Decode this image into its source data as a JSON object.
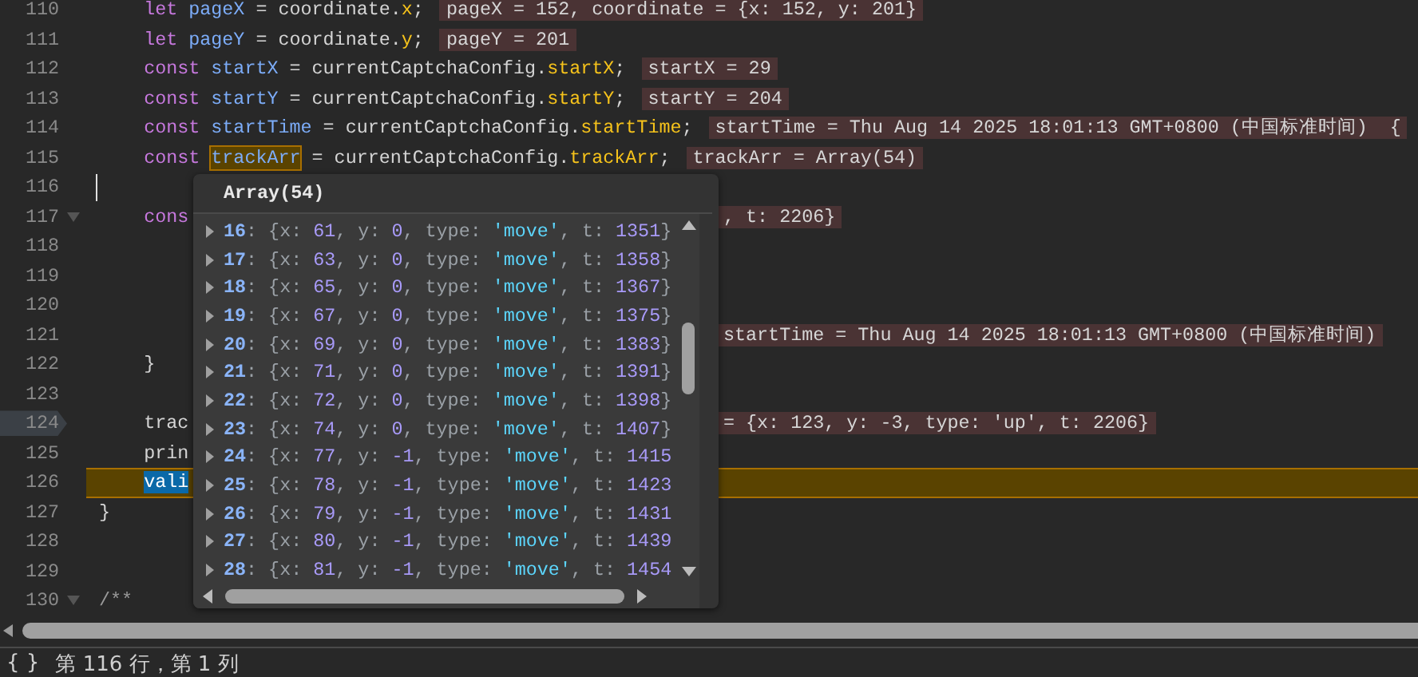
{
  "editor": {
    "lines": [
      {
        "number": "110",
        "paused": false,
        "breakpoint": false,
        "foldable": false,
        "cursor": false,
        "segments": [
          {
            "kind": "kw",
            "text": "    let "
          },
          {
            "kind": "var",
            "text": "pageX"
          },
          {
            "kind": "plain",
            "text": " = coordinate."
          },
          {
            "kind": "prop",
            "text": "x"
          },
          {
            "kind": "plain",
            "text": ";"
          }
        ],
        "inline_value": {
          "text": "pageX = 152, coordinate = {x: 152, y: 201}",
          "behind_popup": false
        }
      },
      {
        "number": "111",
        "paused": false,
        "breakpoint": false,
        "foldable": false,
        "cursor": false,
        "segments": [
          {
            "kind": "kw",
            "text": "    let "
          },
          {
            "kind": "var",
            "text": "pageY"
          },
          {
            "kind": "plain",
            "text": " = coordinate."
          },
          {
            "kind": "prop",
            "text": "y"
          },
          {
            "kind": "plain",
            "text": ";"
          }
        ],
        "inline_value": {
          "text": "pageY = 201",
          "behind_popup": false
        }
      },
      {
        "number": "112",
        "paused": false,
        "breakpoint": false,
        "foldable": false,
        "cursor": false,
        "segments": [
          {
            "kind": "kw",
            "text": "    const "
          },
          {
            "kind": "var",
            "text": "startX"
          },
          {
            "kind": "plain",
            "text": " = currentCaptchaConfig."
          },
          {
            "kind": "prop",
            "text": "startX"
          },
          {
            "kind": "plain",
            "text": ";"
          }
        ],
        "inline_value": {
          "text": "startX = 29",
          "behind_popup": false
        }
      },
      {
        "number": "113",
        "paused": false,
        "breakpoint": false,
        "foldable": false,
        "cursor": false,
        "segments": [
          {
            "kind": "kw",
            "text": "    const "
          },
          {
            "kind": "var",
            "text": "startY"
          },
          {
            "kind": "plain",
            "text": " = currentCaptchaConfig."
          },
          {
            "kind": "prop",
            "text": "startY"
          },
          {
            "kind": "plain",
            "text": ";"
          }
        ],
        "inline_value": {
          "text": "startY = 204",
          "behind_popup": false
        }
      },
      {
        "number": "114",
        "paused": false,
        "breakpoint": false,
        "foldable": false,
        "cursor": false,
        "segments": [
          {
            "kind": "kw",
            "text": "    const "
          },
          {
            "kind": "var",
            "text": "startTime"
          },
          {
            "kind": "plain",
            "text": " = currentCaptchaConfig."
          },
          {
            "kind": "prop",
            "text": "startTime"
          },
          {
            "kind": "plain",
            "text": ";"
          }
        ],
        "inline_value": {
          "text": "startTime = Thu Aug 14 2025 18:01:13 GMT+0800 (中国标准时间)  {",
          "behind_popup": false
        }
      },
      {
        "number": "115",
        "paused": false,
        "breakpoint": false,
        "foldable": false,
        "cursor": false,
        "segments": [
          {
            "kind": "kw",
            "text": "    const "
          },
          {
            "kind": "match",
            "text": "trackArr"
          },
          {
            "kind": "plain",
            "text": " = currentCaptchaConfig."
          },
          {
            "kind": "prop",
            "text": "trackArr"
          },
          {
            "kind": "plain",
            "text": ";"
          }
        ],
        "inline_value": {
          "text": "trackArr = Array(54)",
          "behind_popup": false
        }
      },
      {
        "number": "116",
        "paused": false,
        "breakpoint": false,
        "foldable": false,
        "cursor": true
      },
      {
        "number": "117",
        "paused": false,
        "breakpoint": false,
        "foldable": true,
        "cursor": false,
        "segments": [
          {
            "kind": "kw",
            "text": "    cons"
          }
        ],
        "inline_value": {
          "text": ", t: 2206}",
          "behind_popup": true
        }
      },
      {
        "number": "118",
        "paused": false,
        "breakpoint": false,
        "foldable": false,
        "cursor": false
      },
      {
        "number": "119",
        "paused": false,
        "breakpoint": false,
        "foldable": false,
        "cursor": false
      },
      {
        "number": "120",
        "paused": false,
        "breakpoint": false,
        "foldable": false,
        "cursor": false
      },
      {
        "number": "121",
        "paused": false,
        "breakpoint": false,
        "foldable": false,
        "cursor": false,
        "inline_value": {
          "text": "startTime = Thu Aug 14 2025 18:01:13 GMT+0800 (中国标准时间)",
          "behind_popup": true
        }
      },
      {
        "number": "122",
        "paused": false,
        "breakpoint": false,
        "foldable": false,
        "cursor": false,
        "segments": [
          {
            "kind": "plain",
            "text": "    }"
          }
        ]
      },
      {
        "number": "123",
        "paused": false,
        "breakpoint": false,
        "foldable": false,
        "cursor": false
      },
      {
        "number": "124",
        "paused": false,
        "breakpoint": true,
        "foldable": false,
        "cursor": false,
        "segments": [
          {
            "kind": "plain",
            "text": "    trac"
          }
        ],
        "inline_value": {
          "text": "= {x: 123, y: -3, type: 'up', t: 2206}",
          "behind_popup": true
        }
      },
      {
        "number": "125",
        "paused": false,
        "breakpoint": false,
        "foldable": false,
        "cursor": false,
        "segments": [
          {
            "kind": "plain",
            "text": "    prin"
          }
        ]
      },
      {
        "number": "126",
        "paused": true,
        "breakpoint": false,
        "foldable": false,
        "cursor": false,
        "segments": [
          {
            "kind": "sel",
            "text": "    vali"
          }
        ]
      },
      {
        "number": "127",
        "paused": false,
        "breakpoint": false,
        "foldable": false,
        "cursor": false,
        "segments": [
          {
            "kind": "plain",
            "text": "}"
          }
        ]
      },
      {
        "number": "128",
        "paused": false,
        "breakpoint": false,
        "foldable": false,
        "cursor": false
      },
      {
        "number": "129",
        "paused": false,
        "breakpoint": false,
        "foldable": false,
        "cursor": false
      },
      {
        "number": "130",
        "paused": false,
        "breakpoint": false,
        "foldable": true,
        "cursor": false,
        "segments": [
          {
            "kind": "comment",
            "text": "/**"
          }
        ]
      }
    ]
  },
  "popup": {
    "title": "Array(54)",
    "entries": [
      {
        "index": "16",
        "tokens": [
          {
            "kind": "punct",
            "text": ": {x: "
          },
          {
            "kind": "num",
            "text": "61"
          },
          {
            "kind": "punct",
            "text": ", y: "
          },
          {
            "kind": "num",
            "text": "0"
          },
          {
            "kind": "punct",
            "text": ", type: "
          },
          {
            "kind": "str",
            "text": "'move'"
          },
          {
            "kind": "punct",
            "text": ", t: "
          },
          {
            "kind": "num",
            "text": "1351"
          },
          {
            "kind": "punct",
            "text": "}"
          }
        ]
      },
      {
        "index": "17",
        "tokens": [
          {
            "kind": "punct",
            "text": ": {x: "
          },
          {
            "kind": "num",
            "text": "63"
          },
          {
            "kind": "punct",
            "text": ", y: "
          },
          {
            "kind": "num",
            "text": "0"
          },
          {
            "kind": "punct",
            "text": ", type: "
          },
          {
            "kind": "str",
            "text": "'move'"
          },
          {
            "kind": "punct",
            "text": ", t: "
          },
          {
            "kind": "num",
            "text": "1358"
          },
          {
            "kind": "punct",
            "text": "}"
          }
        ]
      },
      {
        "index": "18",
        "tokens": [
          {
            "kind": "punct",
            "text": ": {x: "
          },
          {
            "kind": "num",
            "text": "65"
          },
          {
            "kind": "punct",
            "text": ", y: "
          },
          {
            "kind": "num",
            "text": "0"
          },
          {
            "kind": "punct",
            "text": ", type: "
          },
          {
            "kind": "str",
            "text": "'move'"
          },
          {
            "kind": "punct",
            "text": ", t: "
          },
          {
            "kind": "num",
            "text": "1367"
          },
          {
            "kind": "punct",
            "text": "}"
          }
        ]
      },
      {
        "index": "19",
        "tokens": [
          {
            "kind": "punct",
            "text": ": {x: "
          },
          {
            "kind": "num",
            "text": "67"
          },
          {
            "kind": "punct",
            "text": ", y: "
          },
          {
            "kind": "num",
            "text": "0"
          },
          {
            "kind": "punct",
            "text": ", type: "
          },
          {
            "kind": "str",
            "text": "'move'"
          },
          {
            "kind": "punct",
            "text": ", t: "
          },
          {
            "kind": "num",
            "text": "1375"
          },
          {
            "kind": "punct",
            "text": "}"
          }
        ]
      },
      {
        "index": "20",
        "tokens": [
          {
            "kind": "punct",
            "text": ": {x: "
          },
          {
            "kind": "num",
            "text": "69"
          },
          {
            "kind": "punct",
            "text": ", y: "
          },
          {
            "kind": "num",
            "text": "0"
          },
          {
            "kind": "punct",
            "text": ", type: "
          },
          {
            "kind": "str",
            "text": "'move'"
          },
          {
            "kind": "punct",
            "text": ", t: "
          },
          {
            "kind": "num",
            "text": "1383"
          },
          {
            "kind": "punct",
            "text": "}"
          }
        ]
      },
      {
        "index": "21",
        "tokens": [
          {
            "kind": "punct",
            "text": ": {x: "
          },
          {
            "kind": "num",
            "text": "71"
          },
          {
            "kind": "punct",
            "text": ", y: "
          },
          {
            "kind": "num",
            "text": "0"
          },
          {
            "kind": "punct",
            "text": ", type: "
          },
          {
            "kind": "str",
            "text": "'move'"
          },
          {
            "kind": "punct",
            "text": ", t: "
          },
          {
            "kind": "num",
            "text": "1391"
          },
          {
            "kind": "punct",
            "text": "}"
          }
        ]
      },
      {
        "index": "22",
        "tokens": [
          {
            "kind": "punct",
            "text": ": {x: "
          },
          {
            "kind": "num",
            "text": "72"
          },
          {
            "kind": "punct",
            "text": ", y: "
          },
          {
            "kind": "num",
            "text": "0"
          },
          {
            "kind": "punct",
            "text": ", type: "
          },
          {
            "kind": "str",
            "text": "'move'"
          },
          {
            "kind": "punct",
            "text": ", t: "
          },
          {
            "kind": "num",
            "text": "1398"
          },
          {
            "kind": "punct",
            "text": "}"
          }
        ]
      },
      {
        "index": "23",
        "tokens": [
          {
            "kind": "punct",
            "text": ": {x: "
          },
          {
            "kind": "num",
            "text": "74"
          },
          {
            "kind": "punct",
            "text": ", y: "
          },
          {
            "kind": "num",
            "text": "0"
          },
          {
            "kind": "punct",
            "text": ", type: "
          },
          {
            "kind": "str",
            "text": "'move'"
          },
          {
            "kind": "punct",
            "text": ", t: "
          },
          {
            "kind": "num",
            "text": "1407"
          },
          {
            "kind": "punct",
            "text": "}"
          }
        ]
      },
      {
        "index": "24",
        "tokens": [
          {
            "kind": "punct",
            "text": ": {x: "
          },
          {
            "kind": "num",
            "text": "77"
          },
          {
            "kind": "punct",
            "text": ", y: "
          },
          {
            "kind": "num",
            "text": "-1"
          },
          {
            "kind": "punct",
            "text": ", type: "
          },
          {
            "kind": "str",
            "text": "'move'"
          },
          {
            "kind": "punct",
            "text": ", t: "
          },
          {
            "kind": "num",
            "text": "1415"
          }
        ]
      },
      {
        "index": "25",
        "tokens": [
          {
            "kind": "punct",
            "text": ": {x: "
          },
          {
            "kind": "num",
            "text": "78"
          },
          {
            "kind": "punct",
            "text": ", y: "
          },
          {
            "kind": "num",
            "text": "-1"
          },
          {
            "kind": "punct",
            "text": ", type: "
          },
          {
            "kind": "str",
            "text": "'move'"
          },
          {
            "kind": "punct",
            "text": ", t: "
          },
          {
            "kind": "num",
            "text": "1423"
          }
        ]
      },
      {
        "index": "26",
        "tokens": [
          {
            "kind": "punct",
            "text": ": {x: "
          },
          {
            "kind": "num",
            "text": "79"
          },
          {
            "kind": "punct",
            "text": ", y: "
          },
          {
            "kind": "num",
            "text": "-1"
          },
          {
            "kind": "punct",
            "text": ", type: "
          },
          {
            "kind": "str",
            "text": "'move'"
          },
          {
            "kind": "punct",
            "text": ", t: "
          },
          {
            "kind": "num",
            "text": "1431"
          }
        ]
      },
      {
        "index": "27",
        "tokens": [
          {
            "kind": "punct",
            "text": ": {x: "
          },
          {
            "kind": "num",
            "text": "80"
          },
          {
            "kind": "punct",
            "text": ", y: "
          },
          {
            "kind": "num",
            "text": "-1"
          },
          {
            "kind": "punct",
            "text": ", type: "
          },
          {
            "kind": "str",
            "text": "'move'"
          },
          {
            "kind": "punct",
            "text": ", t: "
          },
          {
            "kind": "num",
            "text": "1439"
          }
        ]
      },
      {
        "index": "28",
        "tokens": [
          {
            "kind": "punct",
            "text": ": {x: "
          },
          {
            "kind": "num",
            "text": "81"
          },
          {
            "kind": "punct",
            "text": ", y: "
          },
          {
            "kind": "num",
            "text": "-1"
          },
          {
            "kind": "punct",
            "text": ", type: "
          },
          {
            "kind": "str",
            "text": "'move'"
          },
          {
            "kind": "punct",
            "text": ", t: "
          },
          {
            "kind": "num",
            "text": "1454"
          }
        ]
      }
    ]
  },
  "status_bar": {
    "format_button": "{ }",
    "position": "第 116 行，第 1 列"
  }
}
